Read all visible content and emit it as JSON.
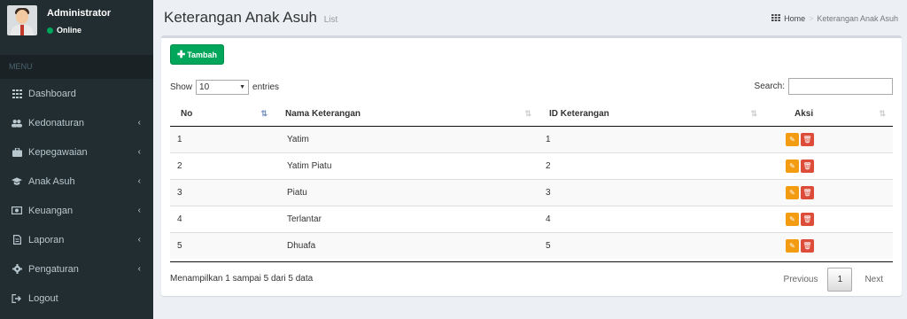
{
  "user": {
    "name": "Administrator",
    "status": "Online"
  },
  "sidebar": {
    "header": "MENU",
    "items": [
      {
        "label": "Dashboard",
        "icon": "grid-icon",
        "has_children": false
      },
      {
        "label": "Kedonaturan",
        "icon": "users-icon",
        "has_children": true
      },
      {
        "label": "Kepegawaian",
        "icon": "briefcase-icon",
        "has_children": true
      },
      {
        "label": "Anak Asuh",
        "icon": "graduation-cap-icon",
        "has_children": true
      },
      {
        "label": "Keuangan",
        "icon": "money-icon",
        "has_children": true
      },
      {
        "label": "Laporan",
        "icon": "file-icon",
        "has_children": true
      },
      {
        "label": "Pengaturan",
        "icon": "gear-icon",
        "has_children": true
      },
      {
        "label": "Logout",
        "icon": "sign-out-icon",
        "has_children": false
      }
    ]
  },
  "header": {
    "title": "Keterangan Anak Asuh",
    "subtitle": "List",
    "breadcrumb": {
      "home": "Home",
      "current": "Keterangan Anak Asuh"
    }
  },
  "toolbar": {
    "add_label": "Tambah"
  },
  "table_controls": {
    "show_label": "Show",
    "length_value": "10",
    "entries_label": "entries",
    "search_label": "Search:",
    "search_value": ""
  },
  "table": {
    "columns": [
      "No",
      "Nama Keterangan",
      "ID Keterangan",
      "Aksi"
    ],
    "rows": [
      {
        "no": "1",
        "nama": "Yatim",
        "id": "1"
      },
      {
        "no": "2",
        "nama": "Yatim Piatu",
        "id": "2"
      },
      {
        "no": "3",
        "nama": "Piatu",
        "id": "3"
      },
      {
        "no": "4",
        "nama": "Terlantar",
        "id": "4"
      },
      {
        "no": "5",
        "nama": "Dhuafa",
        "id": "5"
      }
    ]
  },
  "footer": {
    "info": "Menampilkan 1 sampai 5 dari 5 data",
    "previous": "Previous",
    "current_page": "1",
    "next": "Next"
  },
  "colors": {
    "sidebar_bg": "#222d32",
    "add_green": "#00a65a",
    "edit_orange": "#f39c12",
    "delete_red": "#dd4b39"
  }
}
